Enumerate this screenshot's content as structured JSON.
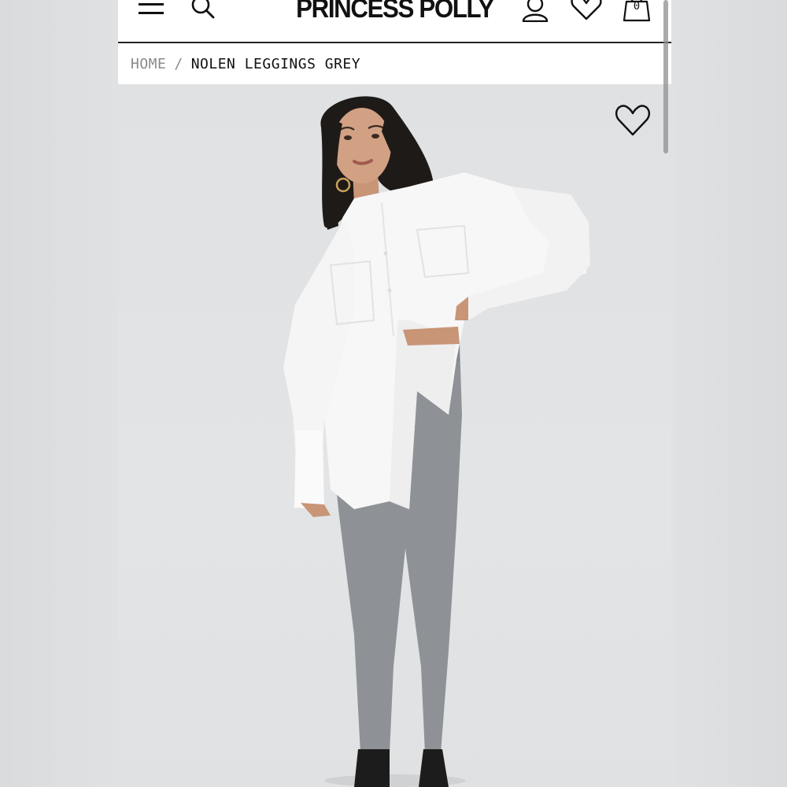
{
  "header": {
    "logo": "PRINCESS POLLY",
    "bag_count": "0",
    "icons": [
      "menu-icon",
      "search-icon",
      "account-icon",
      "wishlist-icon",
      "bag-icon"
    ]
  },
  "breadcrumb": {
    "home": "HOME",
    "separator": "/",
    "current": "NOLEN LEGGINGS GREY"
  },
  "product": {
    "favorite_icon": "heart-outline-icon"
  },
  "colors": {
    "text": "#111111",
    "muted": "#8a8a8a",
    "image_bg": "#e0e2e4",
    "leggings": "#8e9196",
    "shirt": "#f7f7f7"
  }
}
